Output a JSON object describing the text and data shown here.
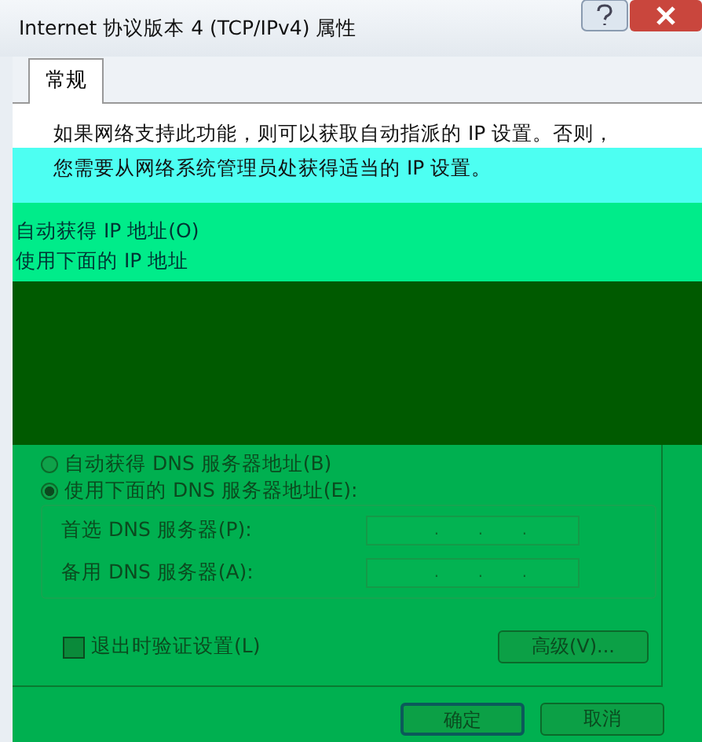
{
  "window": {
    "title": "Internet 协议版本 4 (TCP/IPv4) 属性"
  },
  "tabs": [
    {
      "label": "常规",
      "selected": true
    }
  ],
  "description": [
    "如果网络支持此功能，则可以获取自动指派的 IP 设置。否则，",
    "您需要从网络系统管理员处获得适当的 IP 设置。"
  ],
  "ip_options": [
    "自动获得 IP 地址(O)",
    "使用下面的 IP 地址"
  ],
  "dns_options": [
    {
      "label": "自动获得 DNS 服务器地址(B)",
      "selected": false
    },
    {
      "label": "使用下面的 DNS 服务器地址(E):",
      "selected": true
    }
  ],
  "dns_fields": [
    {
      "label": "首选 DNS 服务器(P):",
      "separator": "."
    },
    {
      "label": "备用 DNS 服务器(A):",
      "separator": "."
    }
  ],
  "validate_on_exit": {
    "label": "退出时验证设置(L)",
    "checked": false
  },
  "advanced_button": "高级(V)...",
  "buttons": [
    {
      "label": "确定",
      "default": true
    },
    {
      "label": "取消",
      "default": false
    }
  ]
}
